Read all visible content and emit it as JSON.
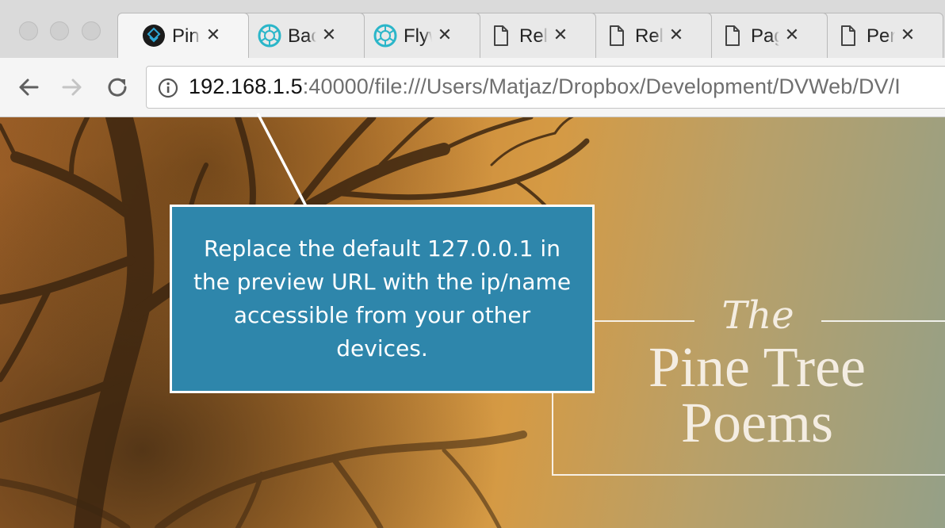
{
  "window": {
    "tabs": [
      {
        "label": "Pine Tree Poems",
        "icon": "pinegrow-icon",
        "active": true
      },
      {
        "label": "Backlog",
        "icon": "aperture-icon",
        "active": false
      },
      {
        "label": "Flywheel",
        "icon": "aperture-icon",
        "active": false
      },
      {
        "label": "Release",
        "icon": "document-icon",
        "active": false
      },
      {
        "label": "Release",
        "icon": "document-icon",
        "active": false
      },
      {
        "label": "Page",
        "icon": "document-icon",
        "active": false
      },
      {
        "label": "Permissions",
        "icon": "document-icon",
        "active": false
      }
    ],
    "close_glyph": "✕"
  },
  "toolbar": {
    "back_icon": "back-arrow-icon",
    "forward_icon": "forward-arrow-icon",
    "reload_icon": "reload-icon",
    "url_host": "192.168.1.5",
    "url_rest": ":40000/file:///Users/Matjaz/Dropbox/Development/DVWeb/DV/I"
  },
  "callout": {
    "text": "Replace the default 127.0.0.1 in the preview URL with the ip/name accessible from your other devices.",
    "background": "#2e86ab"
  },
  "page": {
    "title_prefix": "The",
    "title_line1": "Pine Tree",
    "title_line2": "Poems"
  }
}
